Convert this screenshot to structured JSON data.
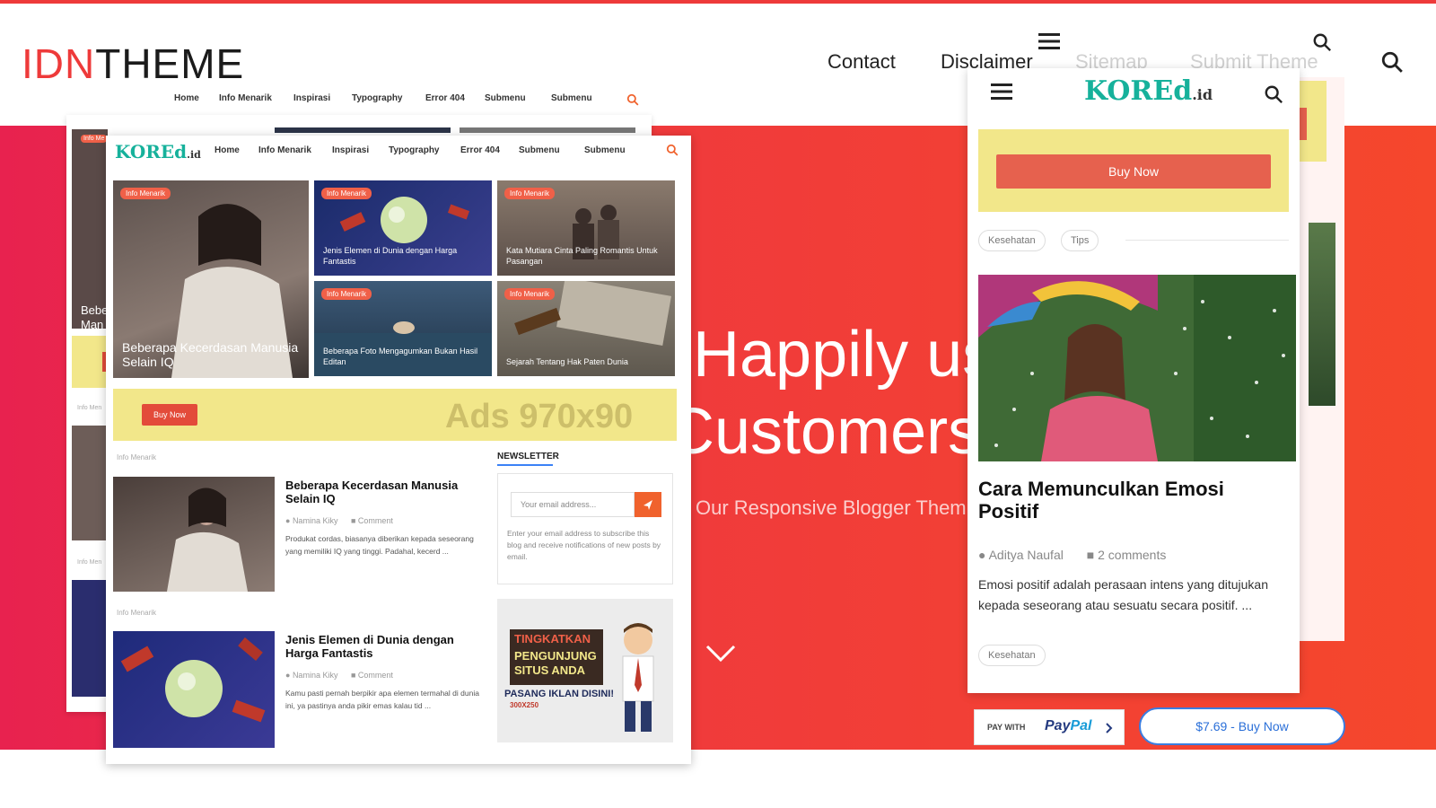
{
  "site": {
    "logo_part1": "IDN",
    "logo_part2": "THEME",
    "nav": [
      "Contact",
      "Disclaimer",
      "Sitemap",
      "Submit Theme"
    ]
  },
  "hero": {
    "line1": "Happily us",
    "line2": "Customers.",
    "subtitle": "Our Responsive Blogger Them"
  },
  "desktop_preview": {
    "brand": "KOREd",
    "brand_suffix": ".id",
    "nav": [
      "Home",
      "Info Menarik",
      "Inspirasi",
      "Typography",
      "Error 404",
      "Submenu",
      "Submenu"
    ],
    "featured": [
      {
        "label": "Info Menarik",
        "title": "Beberapa Kecerdasan Manusia Selain IQ"
      },
      {
        "label": "Info Menarik",
        "title": "Jenis Elemen di Dunia dengan Harga Fantastis"
      },
      {
        "label": "Info Menarik",
        "title": "Kata Mutiara Cinta Paling Romantis Untuk Pasangan"
      },
      {
        "label": "Info Menarik",
        "title": "Beberapa Foto Mengagumkan Bukan Hasil Editan"
      },
      {
        "label": "Info Menarik",
        "title": "Sejarah Tentang Hak Paten Dunia"
      }
    ],
    "ad": {
      "button": "Buy Now",
      "size": "Ads 970x90"
    },
    "posts": [
      {
        "label": "Info Menarik",
        "title": "Beberapa Kecerdasan Manusia Selain IQ",
        "author": "Namina Kiky",
        "comments": "Comment",
        "excerpt": "Produkat cordas, biasanya diberikan kepada seseorang yang memiliki IQ yang tinggi. Padahal, kecerd ..."
      },
      {
        "label": "Info Menarik",
        "title": "Jenis Elemen di Dunia dengan Harga Fantastis",
        "author": "Namina Kiky",
        "comments": "Comment",
        "excerpt": "Kamu pasti pernah berpikir apa elemen termahal di dunia ini, ya pastinya anda pikir emas kalau tid ..."
      }
    ],
    "newsletter": {
      "heading": "NEWSLETTER",
      "placeholder": "Your email address...",
      "description": "Enter your email address to subscribe this blog and receive notifications of new posts by email."
    },
    "promo": {
      "line1": "TINGKATKAN",
      "line2": "PENGUNJUNG",
      "line3": "SITUS ANDA",
      "line4": "PASANG IKLAN DISINI!",
      "size": "300X250"
    }
  },
  "back_preview": {
    "nav": [
      "Home",
      "Info Menarik",
      "Inspirasi",
      "Typography",
      "Error 404",
      "Submenu",
      "Submenu"
    ],
    "badge": "Info Me",
    "caption1": "Bebe",
    "caption2": "Man",
    "label": "Info Men"
  },
  "mobile_preview": {
    "brand": "KOREd",
    "brand_suffix": ".id",
    "buy_now": "Buy Now",
    "tags_top": [
      "Kesehatan",
      "Tips"
    ],
    "title": "Cara Memunculkan Emosi Positif",
    "author": "Aditya Naufal",
    "comments": "2 comments",
    "excerpt": "Emosi positif adalah perasaan intens yang ditujukan kepada seseorang atau sesuatu secara positif. ...",
    "tag_bottom": "Kesehatan"
  },
  "payment": {
    "pay_with": "PAY WITH",
    "paypal_1": "Pay",
    "paypal_2": "Pal",
    "buy_label": "$7.69 - Buy Now"
  },
  "colors": {
    "accent_red": "#ee3a3a",
    "hero_start": "#e8224f",
    "hero_end": "#f5472c",
    "ad_yellow": "#f2e78a",
    "brand_teal": "#16b19b",
    "paypal_blue": "#253b80"
  }
}
